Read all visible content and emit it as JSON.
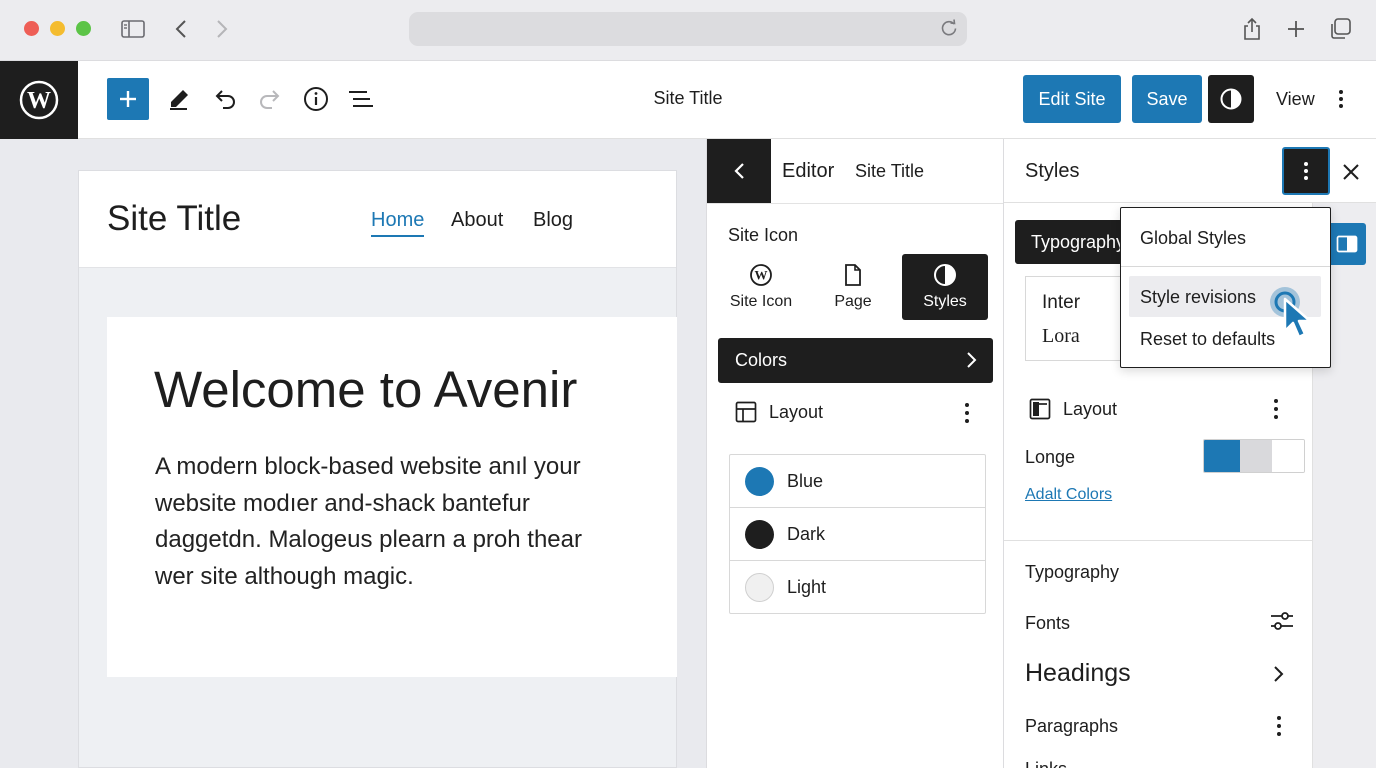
{
  "browser": {
    "url": ""
  },
  "toolbar": {
    "document_title": "Site Title",
    "edit_site_label": "Edit Site",
    "save_label": "Save",
    "view_label": "View"
  },
  "canvas": {
    "site_title": "Site Title",
    "nav": [
      "Home",
      "About",
      "Blog"
    ],
    "hero_title": "Welcome to Avenir",
    "hero_body_lines": [
      "A modern block-based website anıl your",
      "website modıer and-shack bantefur",
      "daggetdn. Malogeus plearn a proh thear",
      "wer site although magic."
    ]
  },
  "editor_panel": {
    "heading": "Editor",
    "site_title": "Site Title",
    "section_label": "Site Icon",
    "tiles": [
      {
        "label": "Site Icon",
        "icon": "wordpress-icon"
      },
      {
        "label": "Page",
        "icon": "page-icon"
      },
      {
        "label": "Styles",
        "icon": "contrast-icon",
        "active": true
      }
    ],
    "colors_label": "Colors",
    "layout_label": "Layout",
    "swatches": [
      {
        "label": "Blue",
        "color": "#1d78b4"
      },
      {
        "label": "Dark",
        "color": "#1e1e1e"
      },
      {
        "label": "Light",
        "color": "#f0f0f0"
      }
    ]
  },
  "styles_panel": {
    "title": "Styles",
    "typography_tab": "Typography",
    "fonts": [
      "Inter",
      "Lora"
    ],
    "layout_label": "Layout",
    "longe_label": "Longe",
    "adalt_link": "Adalt Colors",
    "typography_heading": "Typography",
    "fonts_label": "Fonts",
    "headings_label": "Headings",
    "paragraphs_label": "Paragraphs",
    "partial_label": "Links"
  },
  "dropdown": {
    "items": [
      "Global Styles",
      "Style revisions",
      "Reset to defaults"
    ],
    "hovered_index": 1
  },
  "colors": {
    "accent": "#1d78b4",
    "dark": "#1e1e1e"
  }
}
